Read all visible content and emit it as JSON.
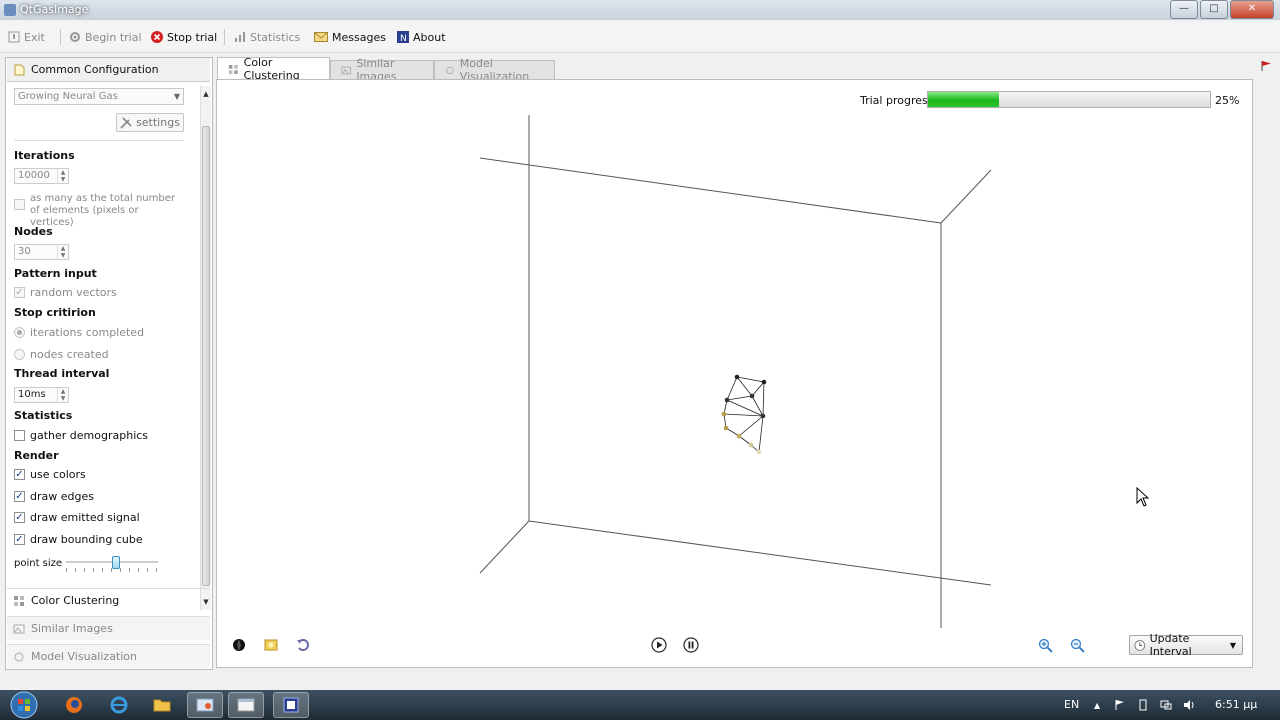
{
  "window": {
    "title": "QtGasImage"
  },
  "toolbar": {
    "exit": "Exit",
    "begin_trial": "Begin trial",
    "stop_trial": "Stop trial",
    "statistics": "Statistics",
    "messages": "Messages",
    "about": "About"
  },
  "sidebar": {
    "common_configuration": "Common Configuration",
    "algorithm": "Growing Neural Gas",
    "settings_button": "settings",
    "iterations_label": "Iterations",
    "iterations_value": "10000",
    "as_many_label": "as many as the total number of elements (pixels or vertices)",
    "nodes_label": "Nodes",
    "nodes_value": "30",
    "pattern_input_label": "Pattern input",
    "random_vectors": "random vectors",
    "stop_criterion_label": "Stop critirion",
    "iterations_completed": "iterations completed",
    "nodes_created": "nodes created",
    "thread_interval_label": "Thread interval",
    "thread_interval_value": "10ms",
    "statistics_label": "Statistics",
    "gather_demographics": "gather demographics",
    "render_label": "Render",
    "use_colors": "use colors",
    "draw_edges": "draw edges",
    "draw_emitted_signal": "draw emitted signal",
    "draw_bounding_cube": "draw bounding cube",
    "point_size_label": "point size",
    "point_size_value": 0.55,
    "color_clustering": "Color Clustering",
    "similar_images": "Similar Images",
    "model_visualization": "Model Visualization"
  },
  "tabs": [
    {
      "label": "Color Clustering"
    },
    {
      "label": "Similar Images"
    },
    {
      "label": "Model Visualization"
    }
  ],
  "main": {
    "trial_progress_label": "Trial progress",
    "trial_progress_value": "25%",
    "trial_progress_fraction": 0.25,
    "update_interval": "Update Interval"
  },
  "taskbar": {
    "language": "EN",
    "clock": "6:51 μμ"
  },
  "colors": {
    "progress": "#19b619",
    "stop_icon": "#d42020",
    "node_dark": "#222222",
    "node_gold": "#b89a4a"
  }
}
